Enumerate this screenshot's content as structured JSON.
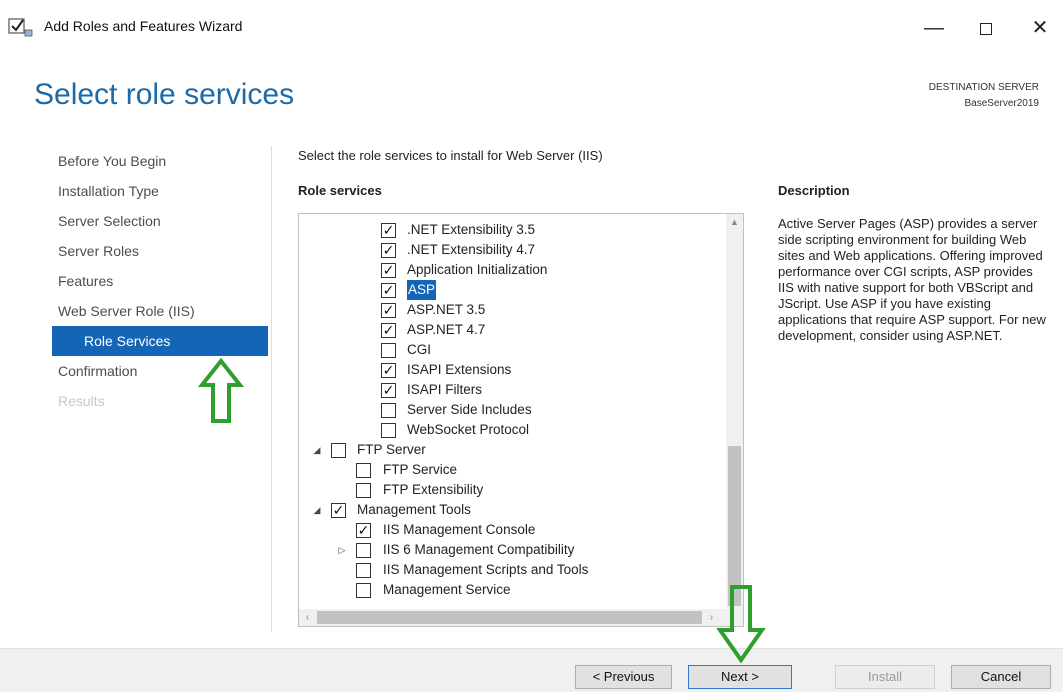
{
  "window": {
    "title": "Add Roles and Features Wizard",
    "minimize_glyph": "—",
    "close_glyph": "✕"
  },
  "header": {
    "page_title": "Select role services",
    "destination_label": "DESTINATION SERVER",
    "destination_server": "BaseServer2019"
  },
  "nav": {
    "items": [
      {
        "label": "Before You Begin"
      },
      {
        "label": "Installation Type"
      },
      {
        "label": "Server Selection"
      },
      {
        "label": "Server Roles"
      },
      {
        "label": "Features"
      },
      {
        "label": "Web Server Role (IIS)"
      },
      {
        "label": "Role Services"
      },
      {
        "label": "Confirmation"
      },
      {
        "label": "Results"
      }
    ],
    "active_item": "Role Services"
  },
  "main": {
    "intro": "Select the role services to install for Web Server (IIS)",
    "role_services_heading": "Role services",
    "items": [
      {
        "label": ".NET Extensibility 3.5",
        "checked": true
      },
      {
        "label": ".NET Extensibility 4.7",
        "checked": true
      },
      {
        "label": "Application Initialization",
        "checked": true
      },
      {
        "label": "ASP",
        "checked": true,
        "selected": true
      },
      {
        "label": "ASP.NET 3.5",
        "checked": true
      },
      {
        "label": "ASP.NET 4.7",
        "checked": true
      },
      {
        "label": "CGI",
        "checked": false
      },
      {
        "label": "ISAPI Extensions",
        "checked": true
      },
      {
        "label": "ISAPI Filters",
        "checked": true
      },
      {
        "label": "Server Side Includes",
        "checked": false
      },
      {
        "label": "WebSocket Protocol",
        "checked": false
      },
      {
        "label": "FTP Server",
        "checked": false,
        "expander": "expanded"
      },
      {
        "label": "FTP Service",
        "checked": false
      },
      {
        "label": "FTP Extensibility",
        "checked": false
      },
      {
        "label": "Management Tools",
        "checked": true,
        "expander": "expanded"
      },
      {
        "label": "IIS Management Console",
        "checked": true
      },
      {
        "label": "IIS 6 Management Compatibility",
        "checked": false,
        "expander": "collapsed"
      },
      {
        "label": "IIS Management Scripts and Tools",
        "checked": false
      },
      {
        "label": "Management Service",
        "checked": false
      }
    ]
  },
  "description": {
    "heading": "Description",
    "text": "Active Server Pages (ASP) provides a server side scripting environment for building Web sites and Web applications. Offering improved performance over CGI scripts, ASP provides IIS with native support for both VBScript and JScript. Use ASP if you have existing applications that require ASP support. For new development, consider using ASP.NET."
  },
  "footer": {
    "previous_label": "< Previous",
    "next_label": "Next >",
    "install_label": "Install",
    "cancel_label": "Cancel"
  },
  "colors": {
    "accent": "#1565b7",
    "title_blue": "#1d6aa8",
    "annotation_green": "#2e9e2e"
  }
}
